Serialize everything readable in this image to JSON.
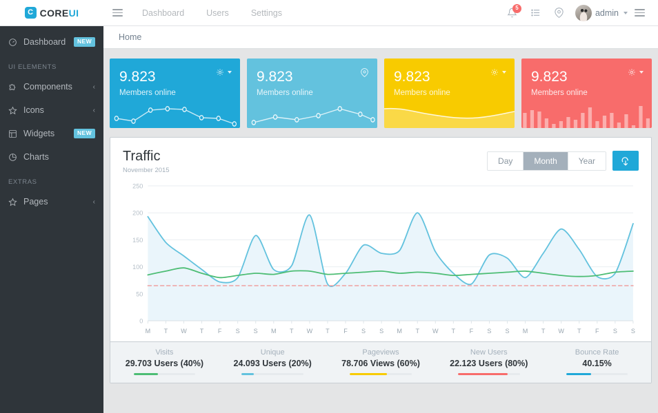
{
  "brand": {
    "name_dark": "CORE",
    "name_light": "UI",
    "mark": "C"
  },
  "topnav": {
    "items": [
      {
        "label": "Dashboard"
      },
      {
        "label": "Users"
      },
      {
        "label": "Settings"
      }
    ]
  },
  "header_right": {
    "bell_badge": "5",
    "username": "admin",
    "icons": [
      "bell-icon",
      "list-icon",
      "location-pin-icon",
      "hamburger-icon"
    ]
  },
  "sidebar": {
    "items": [
      {
        "label": "Dashboard",
        "icon": "speedometer-icon",
        "badge": "NEW",
        "badge_color": "#63c2de"
      },
      {
        "label": "Components",
        "icon": "puzzle-icon",
        "chevron": "‹"
      },
      {
        "label": "Icons",
        "icon": "star-icon",
        "chevron": "‹"
      },
      {
        "label": "Widgets",
        "icon": "grid-icon",
        "badge": "NEW",
        "badge_color": "#63c2de"
      },
      {
        "label": "Charts",
        "icon": "pie-chart-icon"
      },
      {
        "label": "Pages",
        "icon": "star-icon",
        "chevron": "‹"
      }
    ],
    "titles": {
      "ui_elements": "UI ELEMENTS",
      "extras": "EXTRAS"
    }
  },
  "breadcrumb": {
    "current": "Home"
  },
  "widgets": [
    {
      "value": "9.823",
      "label": "Members online",
      "color": "#20a8d8",
      "action_icon": "gear-caret-icon",
      "chart": "line-dots"
    },
    {
      "value": "9.823",
      "label": "Members online",
      "color": "#63c2de",
      "action_icon": "location-pin-icon",
      "chart": "line-dots"
    },
    {
      "value": "9.823",
      "label": "Members online",
      "color": "#f8cb00",
      "action_icon": "gear-caret-icon",
      "chart": "area"
    },
    {
      "value": "9.823",
      "label": "Members online",
      "color": "#f86c6b",
      "action_icon": "gear-caret-icon",
      "chart": "bars"
    }
  ],
  "traffic": {
    "title": "Traffic",
    "subtitle": "November 2015",
    "range_buttons": [
      {
        "label": "Day",
        "active": false
      },
      {
        "label": "Month",
        "active": true
      },
      {
        "label": "Year",
        "active": false
      }
    ],
    "download_button": "download-cloud-icon",
    "stats": [
      {
        "name": "Visits",
        "value": "29.703 Users (40%)",
        "percent": 40,
        "color": "#4dbd74"
      },
      {
        "name": "Unique",
        "value": "24.093 Users (20%)",
        "percent": 20,
        "color": "#63c2de"
      },
      {
        "name": "Pageviews",
        "value": "78.706 Views (60%)",
        "percent": 60,
        "color": "#f8cb00"
      },
      {
        "name": "New Users",
        "value": "22.123 Users (80%)",
        "percent": 80,
        "color": "#f86c6b"
      },
      {
        "name": "Bounce Rate",
        "value": "40.15%",
        "percent": 40,
        "color": "#20a8d8"
      }
    ]
  },
  "chart_data": {
    "type": "line",
    "title": "Traffic",
    "subtitle": "November 2015",
    "xlabel": "",
    "ylabel": "",
    "ylim": [
      0,
      250
    ],
    "yticks": [
      0,
      50,
      100,
      150,
      200,
      250
    ],
    "grid": true,
    "legend_position": "none",
    "x": [
      "M",
      "T",
      "W",
      "T",
      "F",
      "S",
      "S",
      "M",
      "T",
      "W",
      "T",
      "F",
      "S",
      "S",
      "M",
      "T",
      "W",
      "T",
      "F",
      "S",
      "S",
      "M",
      "T",
      "W",
      "T",
      "F",
      "S",
      "S"
    ],
    "series": [
      {
        "name": "Visits",
        "color": "#63c2de",
        "fill": "#eaf5fb",
        "style": "solid",
        "values": [
          193,
          145,
          120,
          95,
          72,
          80,
          158,
          95,
          102,
          196,
          68,
          88,
          140,
          125,
          130,
          200,
          128,
          88,
          68,
          122,
          116,
          80,
          125,
          170,
          132,
          82,
          88,
          180
        ]
      },
      {
        "name": "Unique",
        "color": "#4dbd74",
        "fill": "none",
        "style": "solid",
        "values": [
          85,
          92,
          98,
          88,
          80,
          84,
          88,
          86,
          92,
          92,
          86,
          88,
          90,
          92,
          88,
          90,
          88,
          84,
          86,
          88,
          90,
          92,
          88,
          84,
          82,
          84,
          90,
          92
        ]
      },
      {
        "name": "Bounce Rate",
        "color": "#f0a0a0",
        "fill": "none",
        "style": "dashed",
        "values": [
          65,
          65,
          65,
          65,
          65,
          65,
          65,
          65,
          65,
          65,
          65,
          65,
          65,
          65,
          65,
          65,
          65,
          65,
          65,
          65,
          65,
          65,
          65,
          65,
          65,
          65,
          65,
          65
        ]
      }
    ]
  },
  "widget_sparklines": {
    "card1": [
      30,
      42,
      40,
      16,
      14,
      36,
      40,
      48
    ],
    "card2": [
      44,
      30,
      36,
      28,
      16,
      26,
      36
    ],
    "card3_area": [
      26,
      24,
      28,
      36,
      40,
      38,
      34,
      30
    ],
    "card4_bars": [
      22,
      26,
      24,
      14,
      6,
      10,
      16,
      12,
      22,
      30,
      10,
      18,
      22,
      8,
      20,
      4,
      32,
      14
    ]
  }
}
